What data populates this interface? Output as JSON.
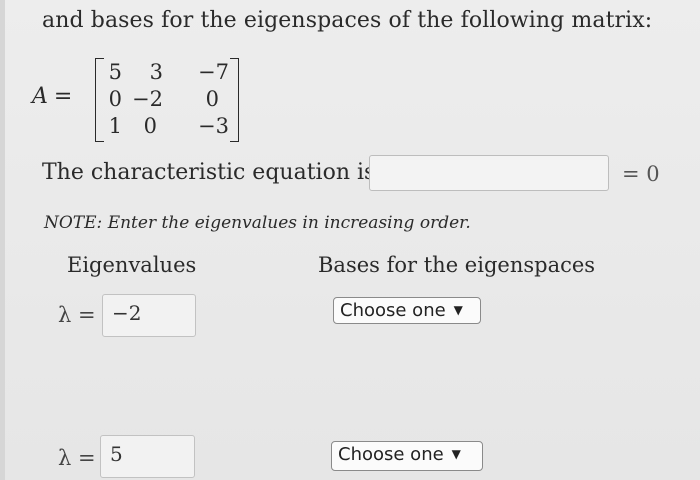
{
  "problem": {
    "intro": "and bases for the eigenspaces of the following matrix:",
    "matrix_name": "A",
    "matrix_equals": "=",
    "matrix": [
      [
        "5",
        "3",
        "−7"
      ],
      [
        "0",
        "−2",
        "0"
      ],
      [
        "1",
        "0",
        "−3"
      ]
    ]
  },
  "characteristic": {
    "label": "The characteristic equation is",
    "value": "",
    "suffix": "= 0"
  },
  "note": "NOTE: Enter the eigenvalues in increasing order.",
  "columns": {
    "eigenvalues": "Eigenvalues",
    "bases": "Bases for the eigenspaces"
  },
  "rows": [
    {
      "lambda_label": "λ =",
      "value": "−2",
      "basis_select": "Choose one"
    },
    {
      "lambda_label": "λ =",
      "value": "5",
      "basis_select": "Choose one"
    }
  ],
  "icons": {
    "dropdown": "triangle-down-icon"
  }
}
